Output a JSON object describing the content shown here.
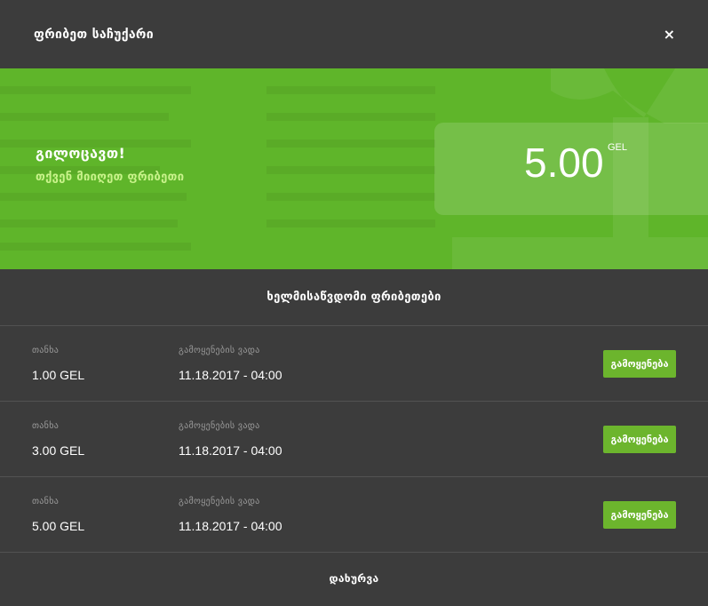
{
  "header": {
    "title": "ფრიბეთ საჩუქარი",
    "close_glyph": "×"
  },
  "banner": {
    "congrats": "გილოცავთ!",
    "received": "თქვენ მიიღეთ ფრიბეთი",
    "amount": "5.00",
    "currency": "GEL"
  },
  "section_title": "ხელმისაწვდომი ფრიბეთები",
  "freebets": [
    {
      "amount_label": "თანხა",
      "amount": "1.00 GEL",
      "expiry_label": "გამოყენების ვადა",
      "expiry": "11.18.2017 - 04:00",
      "button": "გამოყენება"
    },
    {
      "amount_label": "თანხა",
      "amount": "3.00 GEL",
      "expiry_label": "გამოყენების ვადა",
      "expiry": "11.18.2017 - 04:00",
      "button": "გამოყენება"
    },
    {
      "amount_label": "თანხა",
      "amount": "5.00 GEL",
      "expiry_label": "გამოყენების ვადა",
      "expiry": "11.18.2017 - 04:00",
      "button": "გამოყენება"
    }
  ],
  "footer": {
    "close_label": "დახურვა"
  },
  "colors": {
    "background": "#3c3c3c",
    "banner_green": "#5fb52a",
    "button_green": "#6cb52d",
    "accent_light_green": "#c8f28a"
  }
}
